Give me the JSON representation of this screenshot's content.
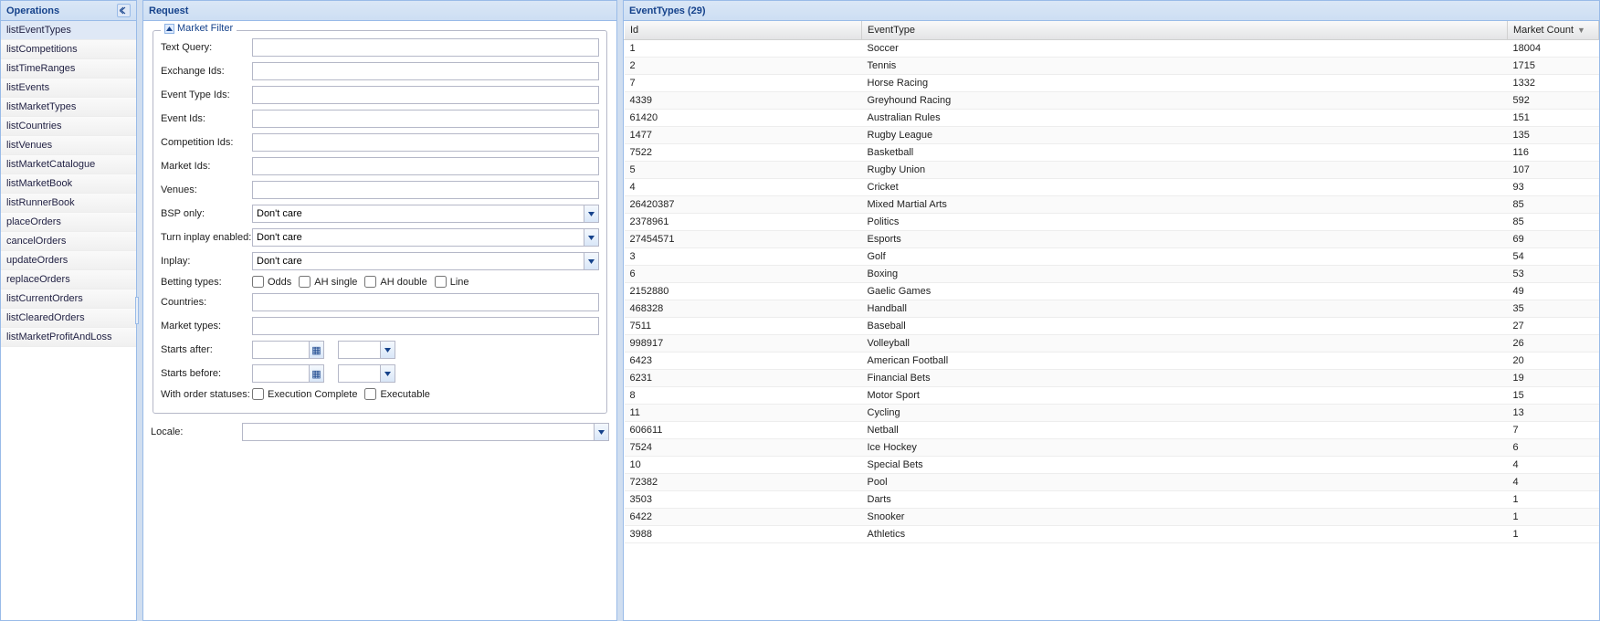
{
  "sidebar": {
    "title": "Operations",
    "items": [
      {
        "label": "listEventTypes",
        "selected": true
      },
      {
        "label": "listCompetitions"
      },
      {
        "label": "listTimeRanges"
      },
      {
        "label": "listEvents"
      },
      {
        "label": "listMarketTypes"
      },
      {
        "label": "listCountries"
      },
      {
        "label": "listVenues"
      },
      {
        "label": "listMarketCatalogue"
      },
      {
        "label": "listMarketBook"
      },
      {
        "label": "listRunnerBook"
      },
      {
        "label": "placeOrders"
      },
      {
        "label": "cancelOrders"
      },
      {
        "label": "updateOrders"
      },
      {
        "label": "replaceOrders"
      },
      {
        "label": "listCurrentOrders"
      },
      {
        "label": "listClearedOrders"
      },
      {
        "label": "listMarketProfitAndLoss"
      }
    ]
  },
  "request": {
    "title": "Request",
    "fieldset_title": "Market Filter",
    "fields": {
      "text_query": "Text Query:",
      "exchange_ids": "Exchange Ids:",
      "event_type_ids": "Event Type Ids:",
      "event_ids": "Event Ids:",
      "competition_ids": "Competition Ids:",
      "market_ids": "Market Ids:",
      "venues": "Venues:",
      "bsp_only": "BSP only:",
      "turn_inplay": "Turn inplay enabled:",
      "inplay": "Inplay:",
      "betting_types": "Betting types:",
      "countries": "Countries:",
      "market_types": "Market types:",
      "starts_after": "Starts after:",
      "starts_before": "Starts before:",
      "with_order_statuses": "With order statuses:"
    },
    "dont_care": "Don't care",
    "betting_type_options": {
      "odds": "Odds",
      "ah_single": "AH single",
      "ah_double": "AH double",
      "line": "Line"
    },
    "order_status_options": {
      "execution_complete": "Execution Complete",
      "executable": "Executable"
    },
    "locale_label": "Locale:"
  },
  "results": {
    "title": "EventTypes (29)",
    "columns": {
      "id": "Id",
      "event_type": "EventType",
      "market_count": "Market Count"
    },
    "rows": [
      {
        "id": "1",
        "event_type": "Soccer",
        "market_count": "18004"
      },
      {
        "id": "2",
        "event_type": "Tennis",
        "market_count": "1715"
      },
      {
        "id": "7",
        "event_type": "Horse Racing",
        "market_count": "1332"
      },
      {
        "id": "4339",
        "event_type": "Greyhound Racing",
        "market_count": "592"
      },
      {
        "id": "61420",
        "event_type": "Australian Rules",
        "market_count": "151"
      },
      {
        "id": "1477",
        "event_type": "Rugby League",
        "market_count": "135"
      },
      {
        "id": "7522",
        "event_type": "Basketball",
        "market_count": "116"
      },
      {
        "id": "5",
        "event_type": "Rugby Union",
        "market_count": "107"
      },
      {
        "id": "4",
        "event_type": "Cricket",
        "market_count": "93"
      },
      {
        "id": "26420387",
        "event_type": "Mixed Martial Arts",
        "market_count": "85"
      },
      {
        "id": "2378961",
        "event_type": "Politics",
        "market_count": "85"
      },
      {
        "id": "27454571",
        "event_type": "Esports",
        "market_count": "69"
      },
      {
        "id": "3",
        "event_type": "Golf",
        "market_count": "54"
      },
      {
        "id": "6",
        "event_type": "Boxing",
        "market_count": "53"
      },
      {
        "id": "2152880",
        "event_type": "Gaelic Games",
        "market_count": "49"
      },
      {
        "id": "468328",
        "event_type": "Handball",
        "market_count": "35"
      },
      {
        "id": "7511",
        "event_type": "Baseball",
        "market_count": "27"
      },
      {
        "id": "998917",
        "event_type": "Volleyball",
        "market_count": "26"
      },
      {
        "id": "6423",
        "event_type": "American Football",
        "market_count": "20"
      },
      {
        "id": "6231",
        "event_type": "Financial Bets",
        "market_count": "19"
      },
      {
        "id": "8",
        "event_type": "Motor Sport",
        "market_count": "15"
      },
      {
        "id": "11",
        "event_type": "Cycling",
        "market_count": "13"
      },
      {
        "id": "606611",
        "event_type": "Netball",
        "market_count": "7"
      },
      {
        "id": "7524",
        "event_type": "Ice Hockey",
        "market_count": "6"
      },
      {
        "id": "10",
        "event_type": "Special Bets",
        "market_count": "4"
      },
      {
        "id": "72382",
        "event_type": "Pool",
        "market_count": "4"
      },
      {
        "id": "3503",
        "event_type": "Darts",
        "market_count": "1"
      },
      {
        "id": "6422",
        "event_type": "Snooker",
        "market_count": "1"
      },
      {
        "id": "3988",
        "event_type": "Athletics",
        "market_count": "1"
      }
    ]
  }
}
